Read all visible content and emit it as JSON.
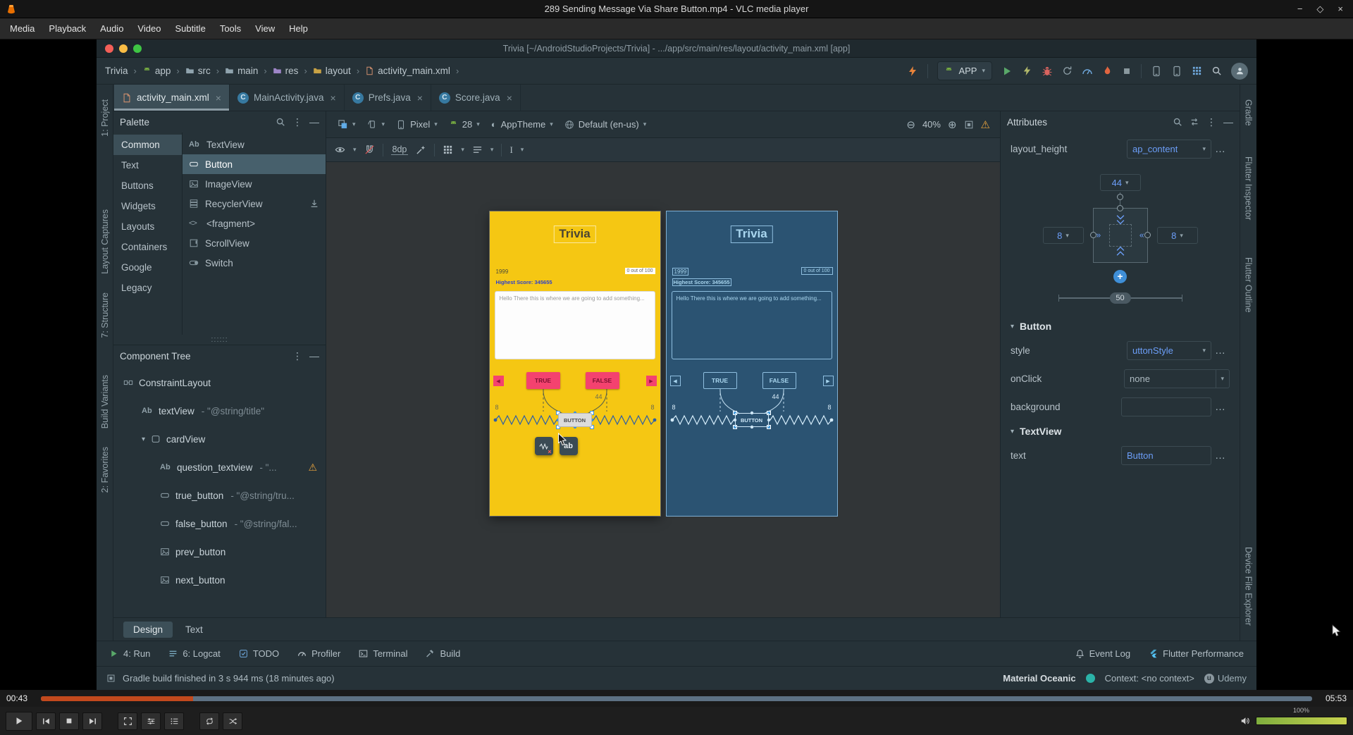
{
  "colors": {
    "accent_blue": "#6c9ef8",
    "warning_orange": "#e8a33d",
    "phone_yellow": "#f5c713",
    "blueprint_blue": "#2b5372",
    "trivia_pink": "#f4426f",
    "progress_orange": "#c2491d",
    "material_teal": "#2bb3a8",
    "run_green": "#59a869",
    "flutter_blue": "#54c5f8"
  },
  "vlc": {
    "title": "289 Sending Message Via Share Button.mp4 - VLC media player",
    "menu": [
      "Media",
      "Playback",
      "Audio",
      "Video",
      "Subtitle",
      "Tools",
      "View",
      "Help"
    ],
    "seek": {
      "current": "00:43",
      "total": "05:53",
      "progress_pct": 12
    },
    "volume": {
      "label": "100%",
      "pct": 100
    }
  },
  "studio": {
    "window_title": "Trivia [~/AndroidStudioProjects/Trivia] - .../app/src/main/res/layout/activity_main.xml [app]",
    "breadcrumb": [
      "Trivia",
      "app",
      "src",
      "main",
      "res",
      "layout",
      "activity_main.xml"
    ],
    "run_config": "APP",
    "left_strip": [
      "1: Project",
      "Layout Captures",
      "7: Structure",
      "Build Variants",
      "2: Favorites"
    ],
    "right_strip": [
      "Gradle",
      "Flutter Inspector",
      "Flutter Outline",
      "Device File Explorer"
    ],
    "tabs": [
      "activity_main.xml",
      "MainActivity.java",
      "Prefs.java",
      "Score.java"
    ],
    "palette": {
      "title": "Palette",
      "categories": [
        "Common",
        "Text",
        "Buttons",
        "Widgets",
        "Layouts",
        "Containers",
        "Google",
        "Legacy"
      ],
      "items": [
        "TextView",
        "Button",
        "ImageView",
        "RecyclerView",
        "<fragment>",
        "ScrollView",
        "Switch"
      ]
    },
    "tree": {
      "title": "Component Tree",
      "items": [
        {
          "name": "ConstraintLayout",
          "suffix": ""
        },
        {
          "name": "textView",
          "suffix": "- \"@string/title\""
        },
        {
          "name": "cardView",
          "suffix": ""
        },
        {
          "name": "question_textview",
          "suffix": "- \"..."
        },
        {
          "name": "true_button",
          "suffix": "- \"@string/tru..."
        },
        {
          "name": "false_button",
          "suffix": "- \"@string/fal..."
        },
        {
          "name": "prev_button",
          "suffix": ""
        },
        {
          "name": "next_button",
          "suffix": ""
        }
      ]
    },
    "design_bar": {
      "device": "Pixel",
      "api": "28",
      "theme": "AppTheme",
      "locale": "Default (en-us)",
      "zoom": "40%",
      "margin": "8dp"
    },
    "preview": {
      "app_title": "Trivia",
      "year": "1999",
      "score": "0 out of 100",
      "highest_score": "Highest Score: 345655",
      "question": "Hello There this is where we are going to add something...",
      "true_label": "TRUE",
      "false_label": "FALSE",
      "button_label": "BUTTON",
      "ab_label": "ab",
      "margin_side": "8",
      "margin_top": "44"
    },
    "attributes": {
      "title": "Attributes",
      "layout_height_label": "layout_height",
      "layout_height_value": "ap_content",
      "constraint": {
        "top": "44",
        "left": "8",
        "right": "8",
        "bias": "50"
      },
      "button_section": "Button",
      "style_label": "style",
      "style_value": "uttonStyle",
      "onclick_label": "onClick",
      "onclick_value": "none",
      "background_label": "background",
      "textview_section": "TextView",
      "text_label": "text",
      "text_value": "Button"
    },
    "bottom_tabs": {
      "design": "Design",
      "text": "Text"
    },
    "windows": [
      "4: Run",
      "6: Logcat",
      "TODO",
      "Profiler",
      "Terminal",
      "Build"
    ],
    "windows_right": [
      "Event Log",
      "Flutter Performance"
    ],
    "status": {
      "message": "Gradle build finished in 3 s 944 ms (18 minutes ago)",
      "theme": "Material Oceanic",
      "context": "Context: <no context>",
      "brand": "Udemy"
    }
  }
}
